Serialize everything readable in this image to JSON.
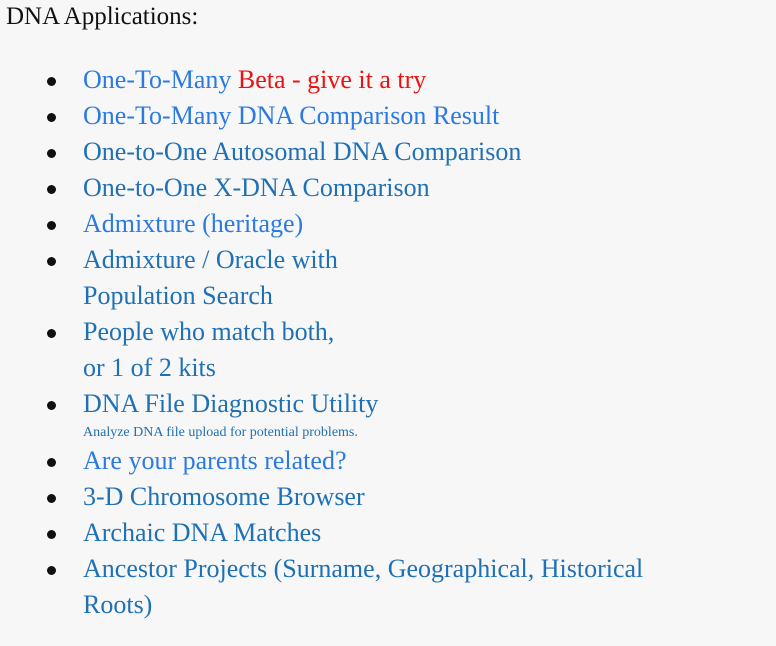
{
  "page": {
    "background_color": "#f7f7f7",
    "title": "DNA Applications:",
    "title_color": "#111111"
  },
  "colors": {
    "link_blue_bright": "#2a7ae2",
    "link_blue_steel": "#1f70b5",
    "accent_red": "#ee1111",
    "bullet_black": "#101010"
  },
  "list": {
    "bullet_style": "disc",
    "items": [
      {
        "id": "one-to-many-beta",
        "lines": [
          "One-To-Many "
        ],
        "label": "One-To-Many ",
        "tone": "bright",
        "suffix": "Beta - give it a try",
        "suffix_color": "#ee1111"
      },
      {
        "id": "one-to-many-result",
        "label": "One-To-Many DNA Comparison Result",
        "tone": "bright"
      },
      {
        "id": "one-to-one-autosomal",
        "label": "One-to-One Autosomal DNA Comparison",
        "tone": "steel"
      },
      {
        "id": "one-to-one-xdna",
        "label": "One-to-One X-DNA Comparison",
        "tone": "steel"
      },
      {
        "id": "admixture-heritage",
        "label": "Admixture (heritage)",
        "tone": "bright"
      },
      {
        "id": "admixture-oracle",
        "label": "Admixture / Oracle with",
        "label_line2": "Population Search",
        "tone": "steel"
      },
      {
        "id": "people-match-both",
        "label": "People who match both,",
        "label_line2": "or 1 of 2 kits",
        "tone": "steel"
      },
      {
        "id": "dna-file-diagnostic",
        "label": "DNA File Diagnostic Utility",
        "tone": "steel",
        "note": "Analyze DNA file upload for potential problems."
      },
      {
        "id": "parents-related",
        "label": "Are your parents related?",
        "tone": "bright"
      },
      {
        "id": "chromosome-browser-3d",
        "label": "3-D Chromosome Browser",
        "tone": "steel"
      },
      {
        "id": "archaic-dna-matches",
        "label": "Archaic DNA Matches",
        "tone": "steel"
      },
      {
        "id": "ancestor-projects",
        "label": "Ancestor Projects (Surname, Geographical, Historical",
        "label_line2": "Roots)",
        "tone": "steel"
      }
    ]
  }
}
